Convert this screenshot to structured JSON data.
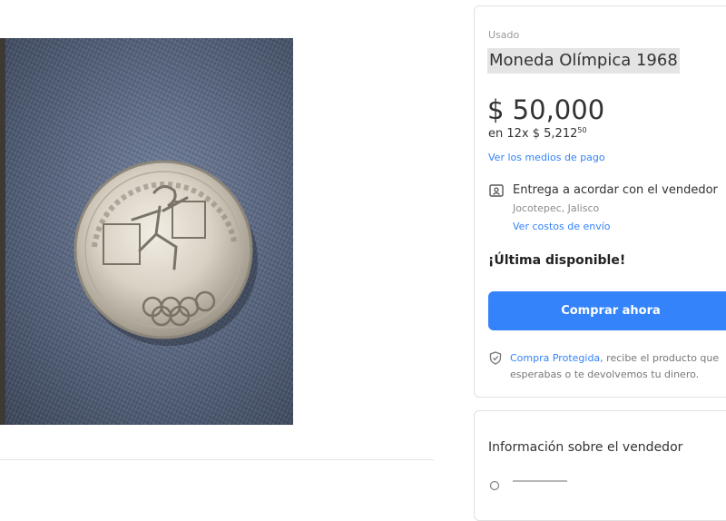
{
  "product": {
    "condition": "Usado",
    "title": "Moneda Olímpica 1968",
    "price": "$ 50,000",
    "installments_prefix": "en 12x $ 5,212",
    "installments_cents": "50",
    "payment_link": "Ver los medios de pago",
    "image_icon": "coin-photo"
  },
  "shipping": {
    "icon": "id-card-icon",
    "title": "Entrega a acordar con el vendedor",
    "location": "Jocotepec, Jalisco",
    "costs_link": "Ver costos de envío"
  },
  "stock": {
    "label": "¡Última disponible!"
  },
  "buy_button": {
    "label": "Comprar ahora"
  },
  "protection": {
    "icon": "shield-check-icon",
    "link": "Compra Protegida",
    "text": ", recibe el producto que esperabas o te devolvemos tu dinero."
  },
  "seller": {
    "title": "Información sobre el vendedor"
  },
  "colors": {
    "accent": "#3483fa",
    "title_highlight": "#e4e4e4",
    "muted": "#9a9a9a"
  }
}
